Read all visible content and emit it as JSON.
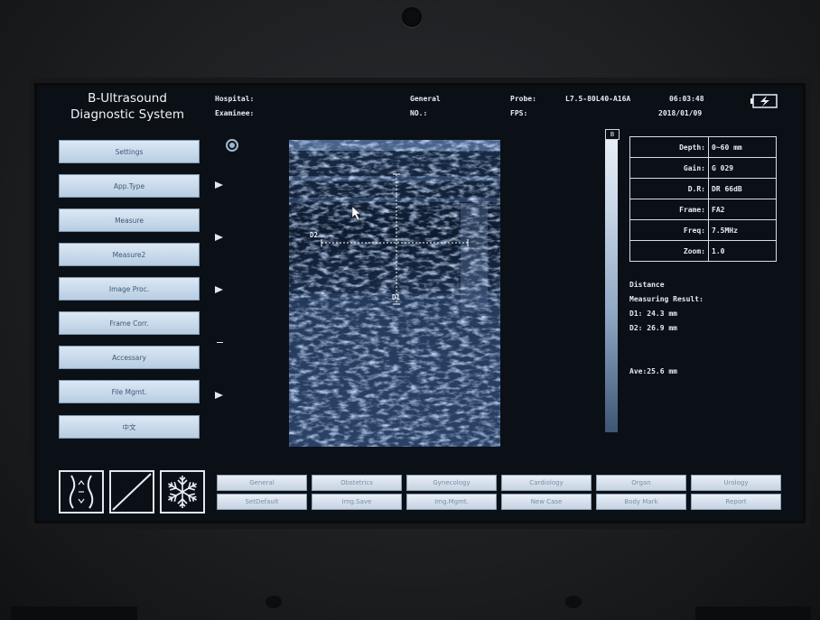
{
  "app": {
    "title_line1": "B-Ultrasound",
    "title_line2": "Diagnostic System"
  },
  "header": {
    "hospital_label": "Hospital:",
    "examinee_label": "Examinee:",
    "mode": "General",
    "no_label": "NO.:",
    "probe_label": "Probe:",
    "probe_value": "L7.5-80L40-A16A",
    "fps_label": "FPS:",
    "time": "06:03:48",
    "date": "2018/01/09",
    "battery_icon": "battery-charging-icon"
  },
  "sidebar": {
    "items": [
      {
        "label": "Settings"
      },
      {
        "label": "App.Type"
      },
      {
        "label": "Measure"
      },
      {
        "label": "Measure2"
      },
      {
        "label": "Image Proc."
      },
      {
        "label": "Frame Corr."
      },
      {
        "label": "Accessary"
      },
      {
        "label": "File Mgmt."
      },
      {
        "label": "中文"
      }
    ]
  },
  "image": {
    "marker_d1": "D1",
    "marker_d2": "D2",
    "scale_label": "B"
  },
  "params": [
    {
      "key": "Depth:",
      "value": "0~60 mm"
    },
    {
      "key": "Gain:",
      "value": "G 029"
    },
    {
      "key": "D.R:",
      "value": "DR 66dB"
    },
    {
      "key": "Frame:",
      "value": "FA2"
    },
    {
      "key": "Freq:",
      "value": "7.5MHz"
    },
    {
      "key": "Zoom:",
      "value": "1.0"
    }
  ],
  "results": {
    "title": "Distance",
    "subtitle": "Measuring Result:",
    "d1": "D1: 24.3 mm",
    "d2": "D2: 26.9 mm",
    "ave": "Ave:25.6 mm"
  },
  "presets_row1": [
    "General",
    "Obstetrics",
    "Gynecology",
    "Cardiology",
    "Organ",
    "Urology"
  ],
  "presets_row2": [
    "SetDefault",
    "Img.Save",
    "Img.Mgmt.",
    "New Case",
    "Body Mark",
    "Report"
  ],
  "colors": {
    "accent": "#c6d3e2",
    "screen_bg": "#0b1016"
  }
}
